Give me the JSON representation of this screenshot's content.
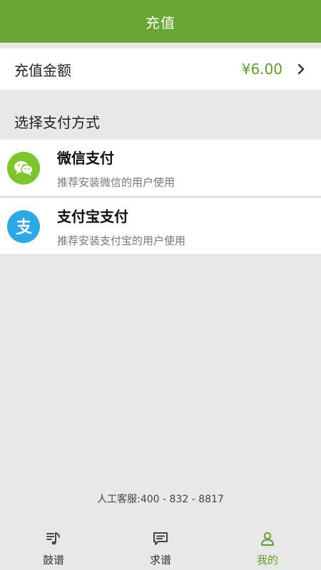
{
  "header": {
    "title": "充值"
  },
  "amount": {
    "label": "充值金额",
    "value": "¥6.00"
  },
  "section": {
    "title": "选择支付方式"
  },
  "payments": [
    {
      "name": "微信支付",
      "desc": "推荐安装微信的用户使用",
      "icon": "wechat-icon"
    },
    {
      "name": "支付宝支付",
      "desc": "推荐安装支付宝的用户使用",
      "icon": "alipay-icon"
    }
  ],
  "service": {
    "text": "人工客服:400 - 832 - 8817"
  },
  "tabs": [
    {
      "label": "鼓谱",
      "icon": "music-score-icon",
      "active": false
    },
    {
      "label": "求谱",
      "icon": "message-icon",
      "active": false
    },
    {
      "label": "我的",
      "icon": "user-icon",
      "active": true
    }
  ],
  "colors": {
    "accent": "#6aa636",
    "wechat": "#7cc52a",
    "alipay": "#2ea7e8"
  }
}
